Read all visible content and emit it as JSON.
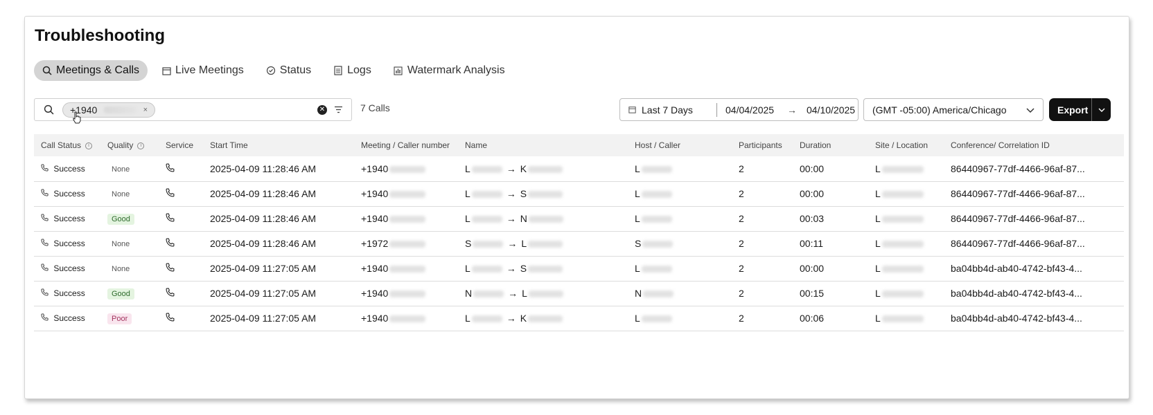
{
  "page_title": "Troubleshooting",
  "tabs": [
    {
      "label": "Meetings & Calls",
      "icon": "search-icon",
      "active": true
    },
    {
      "label": "Live Meetings",
      "icon": "calendar-icon"
    },
    {
      "label": "Status",
      "icon": "check-circle-icon"
    },
    {
      "label": "Logs",
      "icon": "document-icon"
    },
    {
      "label": "Watermark Analysis",
      "icon": "bar-chart-icon"
    }
  ],
  "search": {
    "chip_value": "+1940",
    "chip_remove": "×"
  },
  "result_count": "7 Calls",
  "date_filter": {
    "preset": "Last 7 Days",
    "start": "04/04/2025",
    "arrow": "→",
    "end": "04/10/2025"
  },
  "timezone": "(GMT -05:00) America/Chicago",
  "export_label": "Export",
  "table": {
    "headers": [
      "Call Status",
      "Quality",
      "Service",
      "Start Time",
      "Meeting / Caller number",
      "Name",
      "Host / Caller",
      "Participants",
      "Duration",
      "Site / Location",
      "Conference/ Correlation ID"
    ],
    "rows": [
      {
        "status": "Success",
        "quality": "None",
        "start": "2025-04-09 11:28:46 AM",
        "number": "+1940",
        "name_from": "L",
        "name_to": "K",
        "host": "L",
        "participants": "2",
        "duration": "00:00",
        "site": "L",
        "corr": "86440967-77df-4466-96af-87..."
      },
      {
        "status": "Success",
        "quality": "None",
        "start": "2025-04-09 11:28:46 AM",
        "number": "+1940",
        "name_from": "L",
        "name_to": "S",
        "host": "L",
        "participants": "2",
        "duration": "00:00",
        "site": "L",
        "corr": "86440967-77df-4466-96af-87..."
      },
      {
        "status": "Success",
        "quality": "Good",
        "start": "2025-04-09 11:28:46 AM",
        "number": "+1940",
        "name_from": "L",
        "name_to": "N",
        "host": "L",
        "participants": "2",
        "duration": "00:03",
        "site": "L",
        "corr": "86440967-77df-4466-96af-87..."
      },
      {
        "status": "Success",
        "quality": "None",
        "start": "2025-04-09 11:28:46 AM",
        "number": "+1972",
        "name_from": "S",
        "name_to": "L",
        "host": "S",
        "participants": "2",
        "duration": "00:11",
        "site": "L",
        "corr": "86440967-77df-4466-96af-87..."
      },
      {
        "status": "Success",
        "quality": "None",
        "start": "2025-04-09 11:27:05 AM",
        "number": "+1940",
        "name_from": "L",
        "name_to": "S",
        "host": "L",
        "participants": "2",
        "duration": "00:00",
        "site": "L",
        "corr": "ba04bb4d-ab40-4742-bf43-4..."
      },
      {
        "status": "Success",
        "quality": "Good",
        "start": "2025-04-09 11:27:05 AM",
        "number": "+1940",
        "name_from": "N",
        "name_to": "L",
        "host": "N",
        "participants": "2",
        "duration": "00:15",
        "site": "L",
        "corr": "ba04bb4d-ab40-4742-bf43-4..."
      },
      {
        "status": "Success",
        "quality": "Poor",
        "start": "2025-04-09 11:27:05 AM",
        "number": "+1940",
        "name_from": "L",
        "name_to": "K",
        "host": "L",
        "participants": "2",
        "duration": "00:06",
        "site": "L",
        "corr": "ba04bb4d-ab40-4742-bf43-4..."
      }
    ]
  },
  "colors": {
    "accent_dark": "#111111",
    "good_bg": "#e4f4e0",
    "poor_bg": "#f9e5ee",
    "tab_active_bg": "#d4d4d4"
  }
}
